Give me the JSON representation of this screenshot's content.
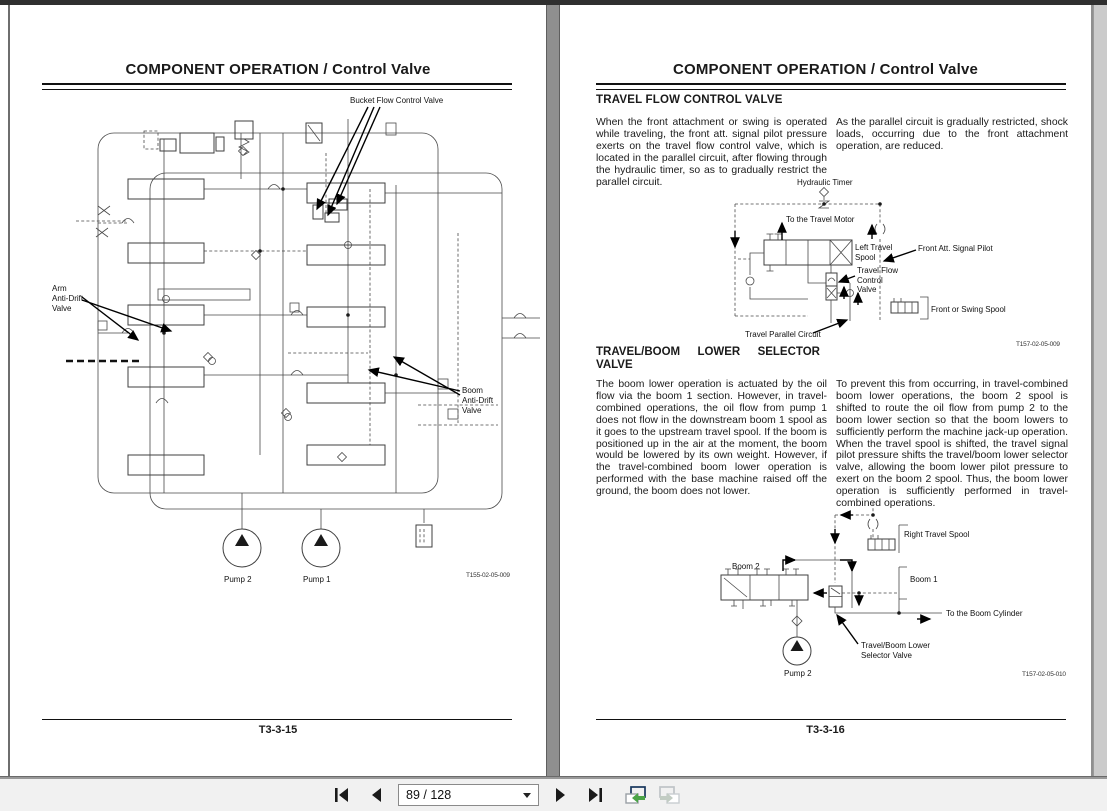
{
  "window": {
    "toolbar": {
      "page_field": "89 / 128"
    }
  },
  "page_left": {
    "title": "COMPONENT OPERATION / Control Valve",
    "figure_id": "T155-02-05-009",
    "footer": "T3-3-15",
    "labels": {
      "bucket_flow_control_valve": "Bucket Flow Control Valve",
      "arm_line1": "Arm",
      "arm_line2": "Anti-Drift",
      "arm_line3": "Valve",
      "boom_line1": "Boom",
      "boom_line2": "Anti-Drift",
      "boom_line3": "Valve",
      "pump2": "Pump 2",
      "pump1": "Pump 1"
    }
  },
  "page_right": {
    "title": "COMPONENT OPERATION / Control Valve",
    "footer": "T3-3-16",
    "section1": {
      "heading": "TRAVEL FLOW CONTROL VALVE",
      "col1": "When the front attachment or swing is operated while traveling, the front att. signal pilot pressure exerts on the travel flow control valve, which is located in the parallel circuit, after flowing through the hydraulic timer, so as to gradually restrict the parallel circuit.",
      "col2": "As the parallel circuit is gradually restricted, shock loads, occurring due to the front attachment operation, are reduced.",
      "figure_id": "T157-02-05-009",
      "labels": {
        "hydraulic_timer": "Hydraulic Timer",
        "to_the_travel_motor": "To the Travel Motor",
        "left_travel_line1": "Left Travel",
        "left_travel_line2": "Spool",
        "travel_flow_line1": "Travel Flow",
        "travel_flow_line2": "Control",
        "travel_flow_line3": "Valve",
        "front_att_signal_pilot": "Front Att. Signal Pilot",
        "front_or_swing_spool": "Front or Swing Spool",
        "travel_parallel_circuit": "Travel Parallel Circuit"
      }
    },
    "section2": {
      "heading_words": [
        "TRAVEL/BOOM",
        "LOWER",
        "SELECTOR"
      ],
      "heading_line2": "VALVE",
      "col1": "The boom lower operation is actuated by the oil flow via the boom 1 section. However, in travel-combined operations, the oil flow from pump 1 does not flow in the downstream boom 1 spool as it goes to the upstream travel spool. If the boom is positioned up in the air at the moment, the boom would be lowered by its own weight. However, if the travel-combined boom lower operation is performed with the base machine raised off the ground, the boom does not lower.",
      "col2a": "To prevent this from occurring, in travel-combined boom lower operations, the boom 2 spool is shifted to route the oil flow from pump 2 to the boom lower section so that the boom lowers to sufficiently perform the machine jack-up operation.",
      "col2b": "When the travel spool is shifted, the travel signal pilot pressure shifts the travel/boom lower selector valve, allowing the boom lower pilot pressure to exert on the boom 2 spool. Thus, the boom lower operation is sufficiently performed in travel-combined operations.",
      "figure_id": "T157-02-05-010",
      "labels": {
        "right_travel_spool": "Right Travel Spool",
        "boom2": "Boom 2",
        "boom1": "Boom 1",
        "to_the_boom_cylinder": "To the Boom Cylinder",
        "selector_line1": "Travel/Boom Lower",
        "selector_line2": "Selector Valve",
        "pump2": "Pump 2"
      }
    }
  }
}
